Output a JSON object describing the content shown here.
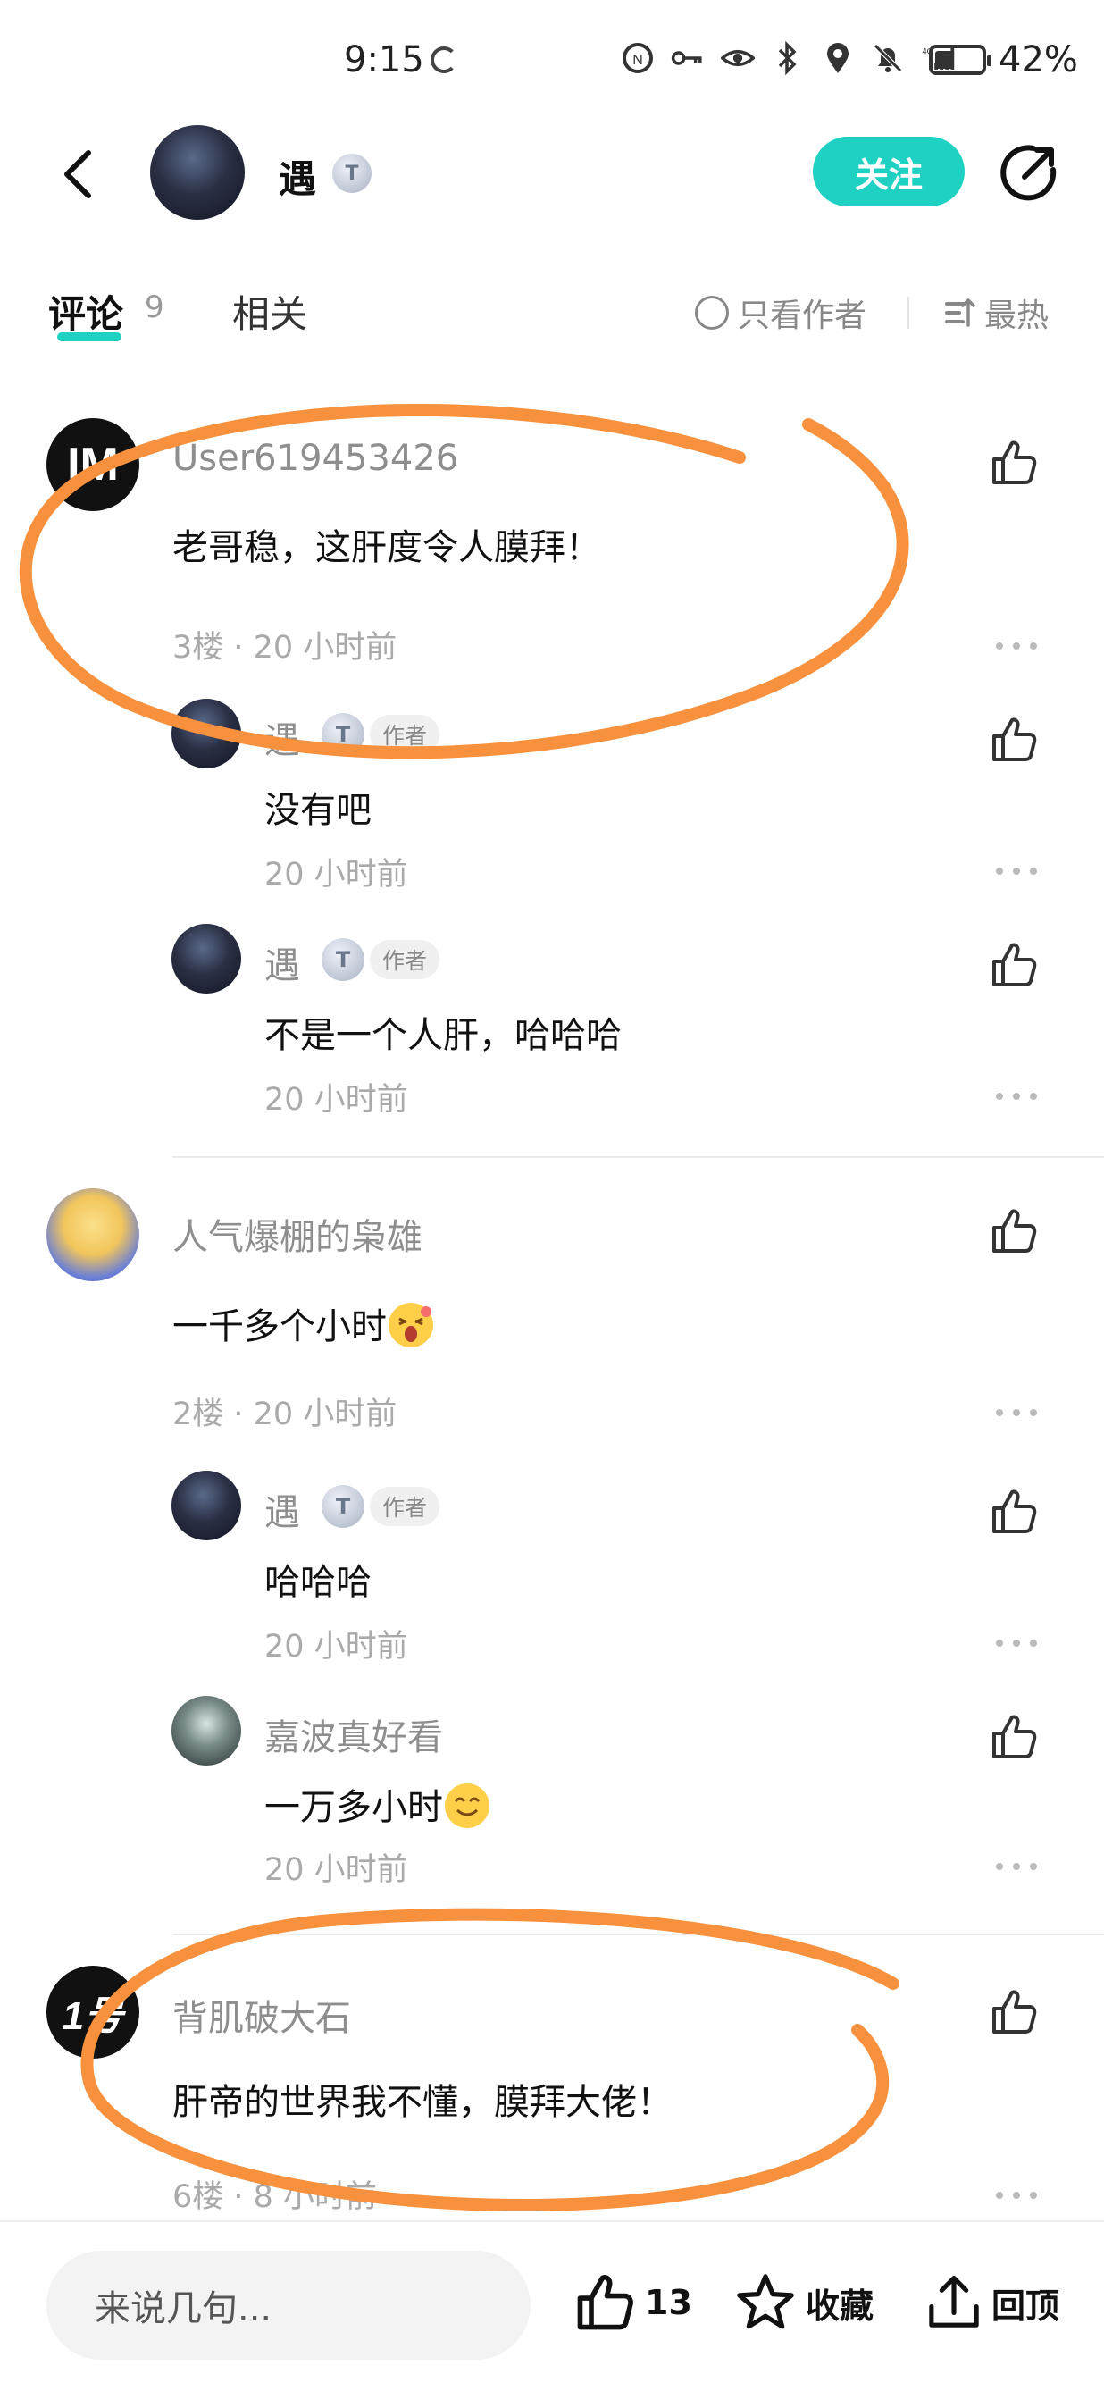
{
  "status_bar": {
    "time": "9:15",
    "battery_text": "42%",
    "battery_level": 0.42,
    "network_label": "4G"
  },
  "header": {
    "user_name": "遇",
    "level_badge": "T",
    "follow_label": "关注"
  },
  "tabs": {
    "comments_label": "评论",
    "comments_count": "9",
    "related_label": "相关",
    "only_author_label": "只看作者",
    "sort_label": "最热"
  },
  "comments": [
    {
      "user": "User619453426",
      "avatar_text": "IM",
      "text": "老哥稳，这肝度令人膜拜！",
      "meta": "3楼 · 20 小时前",
      "replies": [
        {
          "user": "遇",
          "badge": "T",
          "author_tag": "作者",
          "text": "没有吧",
          "meta": "20 小时前"
        },
        {
          "user": "遇",
          "badge": "T",
          "author_tag": "作者",
          "text": "不是一个人肝，哈哈哈",
          "meta": "20 小时前"
        }
      ]
    },
    {
      "user": "人气爆棚的枭雄",
      "text": "一千多个小时",
      "meta": "2楼 · 20 小时前",
      "replies": [
        {
          "user": "遇",
          "badge": "T",
          "author_tag": "作者",
          "text": "哈哈哈",
          "meta": "20 小时前"
        },
        {
          "user": "嘉波真好看",
          "text": "一万多小时",
          "meta": "20 小时前"
        }
      ]
    },
    {
      "user": "背肌破大石",
      "avatar_text": "1号",
      "text": "肝帝的世界我不懂，膜拜大佬！",
      "meta": "6楼 · 8 小时前"
    }
  ],
  "bottom_bar": {
    "input_placeholder": "来说几句...",
    "like_count": "13",
    "favorite_label": "收藏",
    "top_label": "回顶"
  },
  "colors": {
    "accent": "#1ed1c2",
    "annotation": "#f7913d"
  }
}
